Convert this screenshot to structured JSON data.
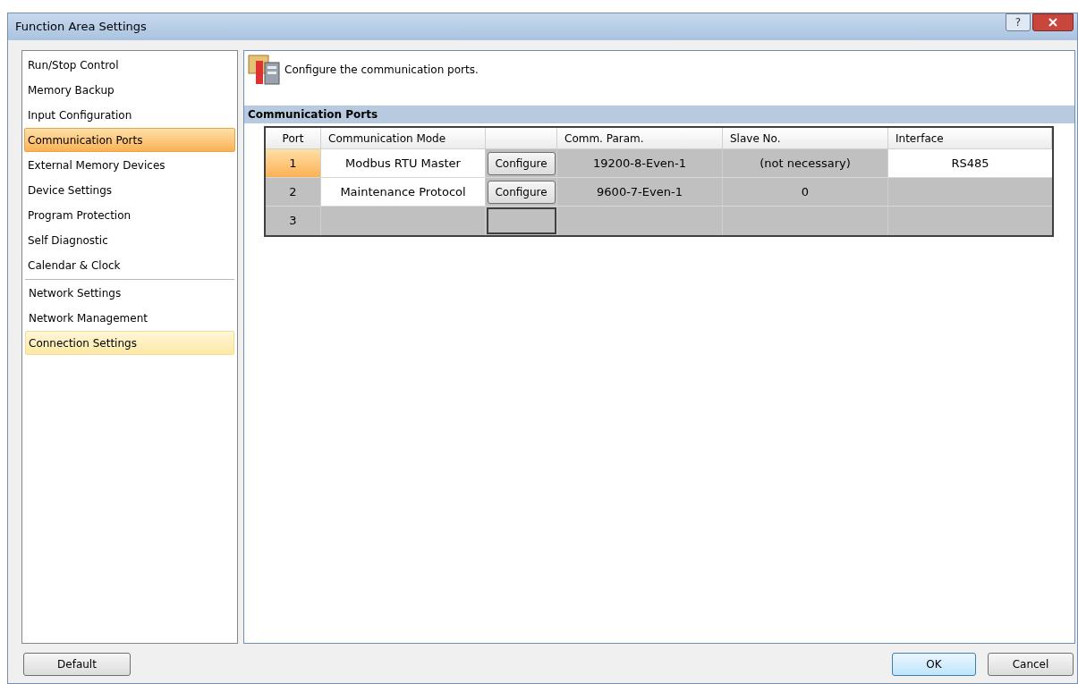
{
  "window": {
    "title": "Function Area Settings",
    "help_button": "?"
  },
  "sidebar": {
    "groups": [
      {
        "items": [
          {
            "label": "Run/Stop Control",
            "selected": false
          },
          {
            "label": "Memory Backup",
            "selected": false
          },
          {
            "label": "Input Configuration",
            "selected": false
          },
          {
            "label": "Communication Ports",
            "selected": true
          },
          {
            "label": "External Memory Devices",
            "selected": false
          },
          {
            "label": "Device Settings",
            "selected": false
          },
          {
            "label": "Program Protection",
            "selected": false
          },
          {
            "label": "Self Diagnostic",
            "selected": false
          },
          {
            "label": "Calendar & Clock",
            "selected": false
          }
        ]
      },
      {
        "items": [
          {
            "label": "Network Settings",
            "selected": false
          },
          {
            "label": "Network Management",
            "selected": false
          },
          {
            "label": "Connection Settings",
            "selected": false,
            "hovered": true
          }
        ]
      }
    ]
  },
  "panel": {
    "description": "Configure the communication ports.",
    "section_title": "Communication Ports",
    "table": {
      "columns": [
        "Port",
        "Communication Mode",
        "",
        "Comm. Param.",
        "Slave No.",
        "Interface"
      ],
      "rows": [
        {
          "port": "1",
          "mode": "Modbus RTU Master",
          "configure": "Configure",
          "comm_param": "19200-8-Even-1",
          "slave_no": "(not necessary)",
          "interface": "RS485",
          "selected": true
        },
        {
          "port": "2",
          "mode": "Maintenance Protocol",
          "configure": "Configure",
          "comm_param": "9600-7-Even-1",
          "slave_no": "0",
          "selected": false
        },
        {
          "port": "3",
          "selected": false
        }
      ]
    }
  },
  "buttons": {
    "default": "Default",
    "ok": "OK",
    "cancel": "Cancel"
  }
}
